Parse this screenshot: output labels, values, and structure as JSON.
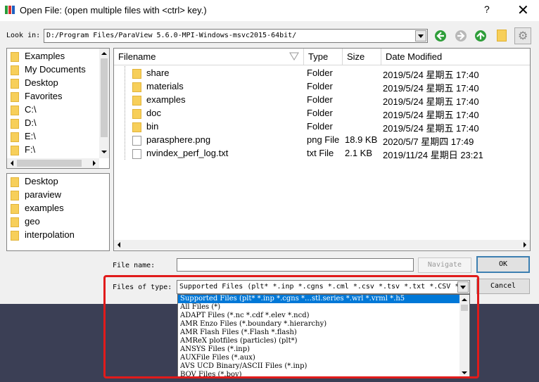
{
  "window": {
    "title": "Open File:  (open multiple files with <ctrl> key.)",
    "help_glyph": "?",
    "close_glyph": "✕"
  },
  "lookin": {
    "label": "Look in:",
    "path": "D:/Program Files/ParaView 5.6.0-MPI-Windows-msvc2015-64bit/"
  },
  "icons": {
    "back": "back-arrow-icon",
    "forward": "forward-arrow-icon",
    "up": "up-arrow-icon",
    "new_folder": "new-folder-icon",
    "settings": "gear-icon"
  },
  "favorites": [
    "Examples",
    "My Documents",
    "Desktop",
    "Favorites",
    "C:\\",
    "D:\\",
    "E:\\",
    "F:\\"
  ],
  "recent": [
    "Desktop",
    "paraview",
    "examples",
    "geo",
    "interpolation"
  ],
  "columns": [
    "Filename",
    "Type",
    "Size",
    "Date Modified"
  ],
  "files": [
    {
      "name": "share",
      "type": "Folder",
      "size": "",
      "date": "2019/5/24 星期五 17:40",
      "kind": "folder"
    },
    {
      "name": "materials",
      "type": "Folder",
      "size": "",
      "date": "2019/5/24 星期五 17:40",
      "kind": "folder"
    },
    {
      "name": "examples",
      "type": "Folder",
      "size": "",
      "date": "2019/5/24 星期五 17:40",
      "kind": "folder"
    },
    {
      "name": "doc",
      "type": "Folder",
      "size": "",
      "date": "2019/5/24 星期五 17:40",
      "kind": "folder"
    },
    {
      "name": "bin",
      "type": "Folder",
      "size": "",
      "date": "2019/5/24 星期五 17:40",
      "kind": "folder"
    },
    {
      "name": "parasphere.png",
      "type": "png File",
      "size": "18.9 KB",
      "date": "2020/5/7 星期四 17:49",
      "kind": "file"
    },
    {
      "name": "nvindex_perf_log.txt",
      "type": "txt File",
      "size": "2.1 KB",
      "date": "2019/11/24 星期日 23:21",
      "kind": "file"
    }
  ],
  "filename": {
    "label": "File name:",
    "value": "",
    "navigate_label": "Navigate",
    "ok_label": "OK"
  },
  "filetype": {
    "label": "Files of type:",
    "value": "Supported Files (plt* *.inp *.cgns *.cml *.csv *.tsv *.txt *.CSV *",
    "cancel_label": "Cancel",
    "options": [
      "Supported Files (plt* *.inp *.cgns *…stl.series *.wrl *.vrml *.h5",
      "All Files (*)",
      "ADAPT Files (*.nc *.cdf *.elev *.ncd)",
      "AMR Enzo Files (*.boundary *.hierarchy)",
      "AMR Flash Files (*.Flash *.flash)",
      "AMReX plotfiles (particles) (plt*)",
      "ANSYS Files (*.inp)",
      "AUXFile Files (*.aux)",
      "AVS UCD Binary/ASCII Files (*.inp)",
      "BOV Files (*.bov)"
    ]
  },
  "colors": {
    "selection": "#0078d7",
    "highlight_box": "#e11b1b",
    "folder": "#f7cf5a"
  }
}
